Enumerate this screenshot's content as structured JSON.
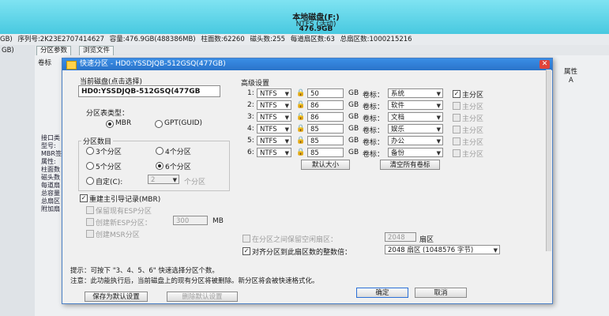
{
  "disk_banner": {
    "name": "本地磁盘(F:)",
    "fs": "NTFS (活动)",
    "size": "476.9GB"
  },
  "info_line": {
    "left_cut": "GB)",
    "serial": "序列号:2K23E2707414627",
    "capacity": "容量:476.9GB(488386MB)",
    "cylinders": "柱面数:62260",
    "heads": "磁头数:255",
    "sectors_per_track": "每道扇区数:63",
    "total_sectors": "总扇区数:1000215216"
  },
  "bg_app": {
    "left_top": "GB)",
    "tab_params": "分区参数",
    "tab_browse": "浏览文件",
    "vol_label": "卷标",
    "attr_label": "属性",
    "attr_value": "A",
    "side_list": [
      "接口类",
      "型号:",
      "MBR签",
      "属性:",
      "",
      "柱面数",
      "磁头数",
      "每道扇",
      "总容量",
      "总扇区",
      "附加扇"
    ]
  },
  "dialog": {
    "title": "快速分区 - HD0:YSSDJQB-512GSQ(477GB)",
    "close": "✕",
    "current_disk_label": "当前磁盘(点击选择)",
    "current_disk_value": "HD0:YSSDJQB-512GSQ(477GB",
    "table_type_label": "分区表类型：",
    "mbr": "MBR",
    "gpt": "GPT(GUID)",
    "count_label": "分区数目",
    "count_options": [
      "3个分区",
      "4个分区",
      "5个分区",
      "6个分区",
      "自定(C):"
    ],
    "custom_value": "2",
    "custom_suffix": "个分区",
    "rebuild_mbr": "重建主引导记录(MBR)",
    "keep_esp": "保留现有ESP分区",
    "new_esp": "创建新ESP分区：",
    "esp_size": "300",
    "esp_unit": "MB",
    "msr": "创建MSR分区",
    "advanced_label": "高级设置",
    "gb": "GB",
    "vol_word": "卷标：",
    "primary": "主分区",
    "partitions": [
      {
        "idx": "1:",
        "fs": "NTFS",
        "size": "50",
        "label": "系统",
        "primary": true
      },
      {
        "idx": "2:",
        "fs": "NTFS",
        "size": "86",
        "label": "软件",
        "primary": false
      },
      {
        "idx": "3:",
        "fs": "NTFS",
        "size": "86",
        "label": "文档",
        "primary": false
      },
      {
        "idx": "4:",
        "fs": "NTFS",
        "size": "85",
        "label": "娱乐",
        "primary": false
      },
      {
        "idx": "5:",
        "fs": "NTFS",
        "size": "85",
        "label": "办公",
        "primary": false
      },
      {
        "idx": "6:",
        "fs": "NTFS",
        "size": "85",
        "label": "备份",
        "primary": false
      }
    ],
    "default_size_btn": "默认大小",
    "clear_labels_btn": "清空所有卷标",
    "keep_free_label": "在分区之间保留空闲扇区：",
    "keep_free_value": "2048",
    "keep_free_unit": "扇区",
    "align_label": "对齐分区到此扇区数的整数倍：",
    "align_value": "2048 扇区 (1048576 字节)",
    "tip1": "提示：可按下 \"3、4、5、6\" 快速选择分区个数。",
    "tip2": "注意：此功能执行后，当前磁盘上的现有分区将被删除。新分区将会被快速格式化。",
    "save_default_btn": "保存为默认设置",
    "delete_default_btn": "删除默认设置",
    "ok_btn": "确定",
    "cancel_btn": "取消"
  }
}
